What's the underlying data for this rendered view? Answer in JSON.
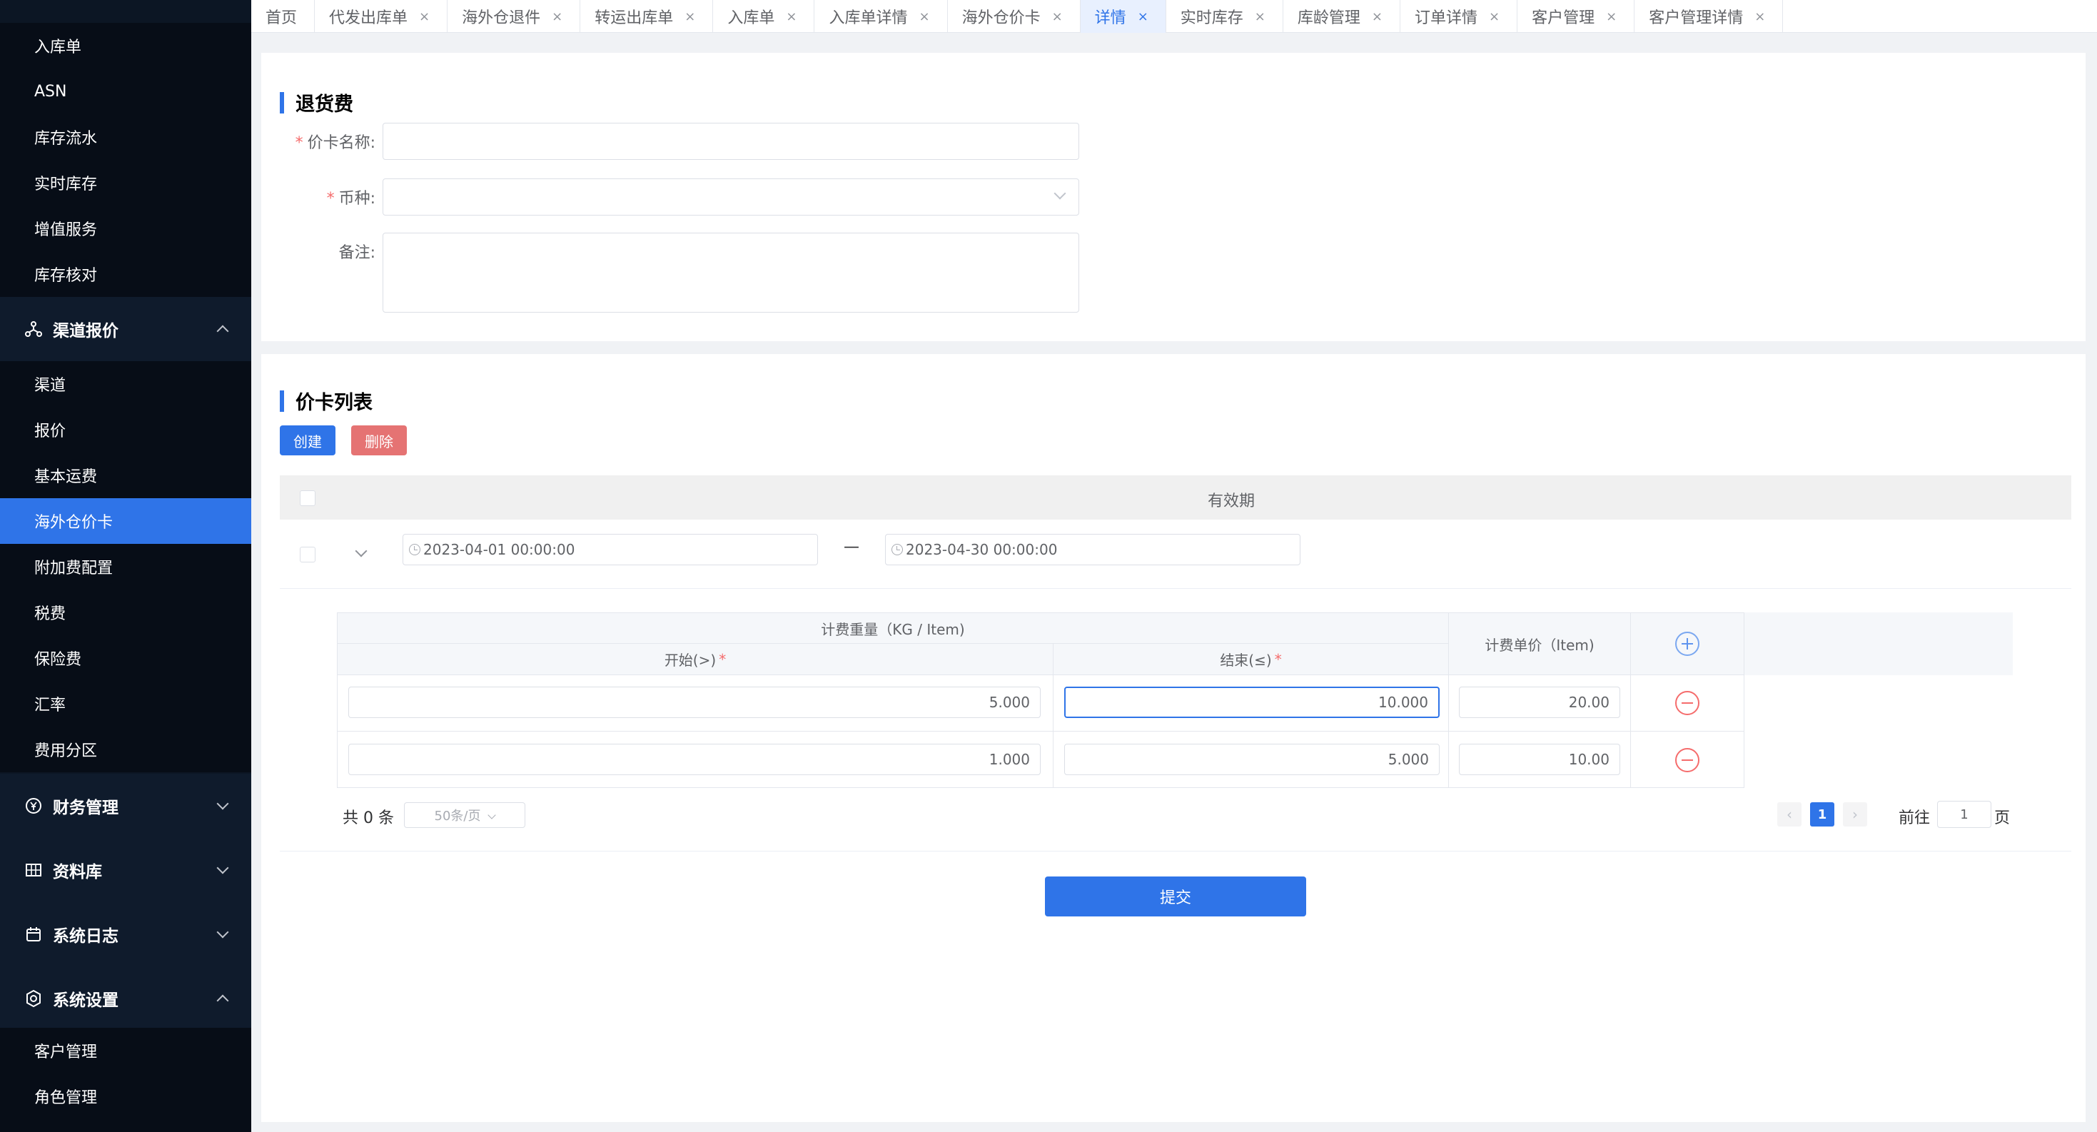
{
  "sidebar": {
    "group_warehouse_items": [
      "入库单",
      "ASN",
      "库存流水",
      "实时库存",
      "增值服务",
      "库存核对"
    ],
    "group_channel": {
      "label": "渠道报价",
      "items": [
        "渠道",
        "报价",
        "基本运费",
        "海外仓价卡",
        "附加费配置",
        "税费",
        "保险费",
        "汇率",
        "费用分区"
      ],
      "active": "海外仓价卡"
    },
    "group_finance": {
      "label": "财务管理"
    },
    "group_library": {
      "label": "资料库"
    },
    "group_logs": {
      "label": "系统日志"
    },
    "group_settings": {
      "label": "系统设置",
      "items": [
        "客户管理",
        "角色管理"
      ]
    }
  },
  "tabs": [
    {
      "label": "首页",
      "closable": false
    },
    {
      "label": "代发出库单",
      "closable": true
    },
    {
      "label": "海外仓退件",
      "closable": true
    },
    {
      "label": "转运出库单",
      "closable": true
    },
    {
      "label": "入库单",
      "closable": true
    },
    {
      "label": "入库单详情",
      "closable": true
    },
    {
      "label": "海外仓价卡",
      "closable": true
    },
    {
      "label": "详情",
      "closable": true,
      "active": true
    },
    {
      "label": "实时库存",
      "closable": true
    },
    {
      "label": "库龄管理",
      "closable": true
    },
    {
      "label": "订单详情",
      "closable": true
    },
    {
      "label": "客户管理",
      "closable": true
    },
    {
      "label": "客户管理详情",
      "closable": true
    }
  ],
  "form": {
    "title": "退货费",
    "name_label": "价卡名称:",
    "currency_label": "币种:",
    "remark_label": "备注:"
  },
  "list": {
    "title": "价卡列表",
    "create_btn": "创建",
    "delete_btn": "删除",
    "validity_header": "有效期",
    "date_start": "2023-04-01 00:00:00",
    "date_end": "2023-04-30 00:00:00",
    "date_sep": "—",
    "weight_header": "计费重量（KG / Item)",
    "start_header": "开始(>)",
    "end_header": "结束(≤)",
    "price_header": "计费单价（Item)",
    "rows": [
      {
        "start": "5.000",
        "end": "10.000",
        "price": "20.00"
      },
      {
        "start": "1.000",
        "end": "5.000",
        "price": "10.00"
      }
    ],
    "total": "共 0 条",
    "page_size": "50条/页",
    "current_page": "1",
    "goto_label": "前往",
    "goto_value": "1",
    "page_suffix": "页",
    "submit": "提交"
  },
  "colors": {
    "primary": "#2f74e8",
    "danger": "#e57373",
    "sidebar_bg": "#0c1624"
  }
}
